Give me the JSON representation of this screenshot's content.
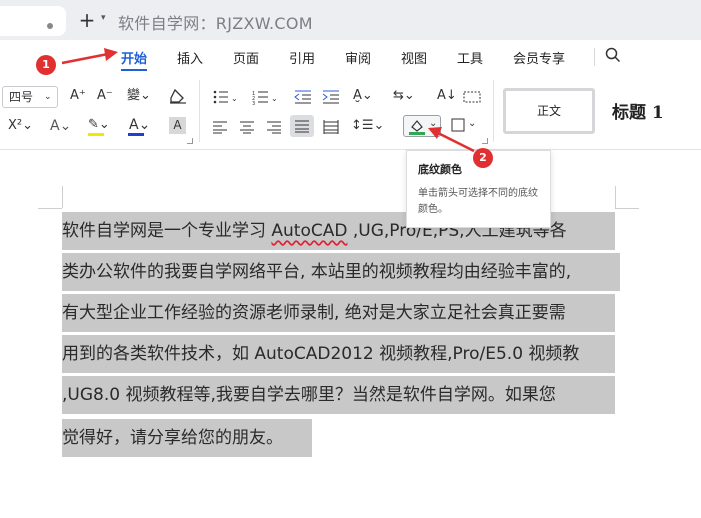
{
  "titlebar": {
    "new_tab": "+",
    "watermark": "软件自学网：RJZXW.COM"
  },
  "menu": {
    "items": [
      "开始",
      "插入",
      "页面",
      "引用",
      "审阅",
      "视图",
      "工具",
      "会员专享"
    ]
  },
  "ribbon": {
    "font_size": "四号",
    "styles": {
      "normal": "正文",
      "heading1": "标题 1"
    },
    "icons": [
      "grow-font-icon",
      "shrink-font-icon",
      "phonetic-guide-icon",
      "clear-format-icon",
      "superscript-icon",
      "text-effect-icon",
      "highlight-icon",
      "font-color-icon",
      "char-shading-icon",
      "bullet-list-icon",
      "numbered-list-icon",
      "decrease-indent-icon",
      "increase-indent-icon",
      "chinese-layout-icon",
      "sort-icon",
      "show-marks-icon",
      "align-left-icon",
      "align-center-icon",
      "align-right-icon",
      "justify-icon",
      "distributed-icon",
      "line-spacing-icon",
      "paragraph-spacing-icon",
      "shading-color-icon",
      "border-icon",
      "search-icon"
    ]
  },
  "tooltip": {
    "title": "底纹颜色",
    "description": "单击箭头可选择不同的底纹颜色。"
  },
  "document": {
    "lines": [
      [
        "软件自学网是一个专业学习 ",
        "AutoCAD",
        " ,UG,Pro/E,PS,人工建筑等各"
      ],
      "类办公软件的我要自学网络平台, 本站里的视频教程均由经验丰富的,",
      "有大型企业工作经验的资源老师录制, 绝对是大家立足社会真正要需",
      "用到的各类软件技术，如 AutoCAD2012 视频教程,Pro/E5.0 视频教",
      ",UG8.0 视频教程等,我要自学去哪里？当然是软件自学网。如果您",
      "觉得好，请分享给您的朋友。"
    ]
  },
  "annotations": {
    "badge1": "1",
    "badge2": "2"
  },
  "colors": {
    "accent": "#1f5fd8",
    "selection": "#c8c8c8",
    "badge": "#e03030"
  }
}
